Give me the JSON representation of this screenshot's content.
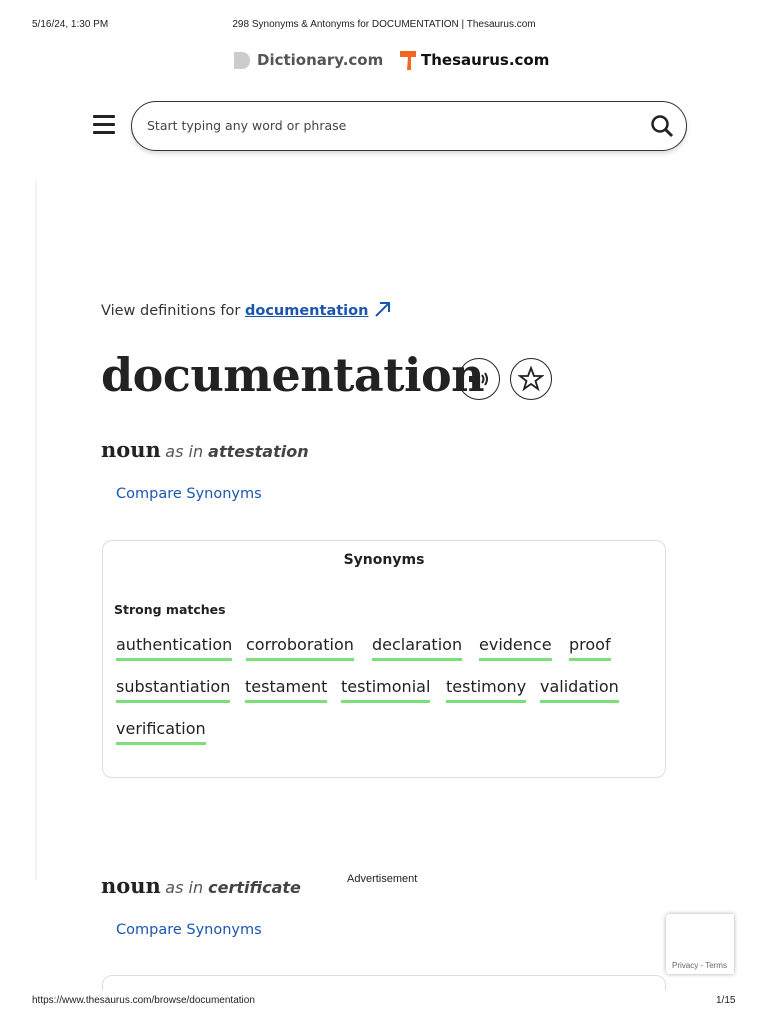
{
  "browser": {
    "datetime": "5/16/24, 1:30 PM",
    "title": "298 Synonyms & Antonyms for DOCUMENTATION | Thesaurus.com",
    "url": "https://www.thesaurus.com/browse/documentation",
    "page": "1/15"
  },
  "brand": {
    "dictionary": "Dictionary.com",
    "thesaurus": "Thesaurus.com",
    "thesaurus_color": "#f26722"
  },
  "search": {
    "placeholder": "Start typing any word or phrase"
  },
  "view_defs": {
    "prefix": "View definitions for ",
    "word": "documentation"
  },
  "headword": "documentation",
  "sense1": {
    "pos": "noun",
    "asin": "as in",
    "word": "attestation",
    "compare": "Compare Synonyms",
    "card_title": "Synonyms",
    "strong": "Strong matches",
    "words": [
      "authentication",
      "corroboration",
      "declaration",
      "evidence",
      "proof",
      "substantiation",
      "testament",
      "testimonial",
      "testimony",
      "validation",
      "verification"
    ]
  },
  "sense2": {
    "pos": "noun",
    "asin": "as in",
    "word": "certificate",
    "compare": "Compare Synonyms"
  },
  "ad": "Advertisement",
  "recaptcha": "Privacy - Terms"
}
